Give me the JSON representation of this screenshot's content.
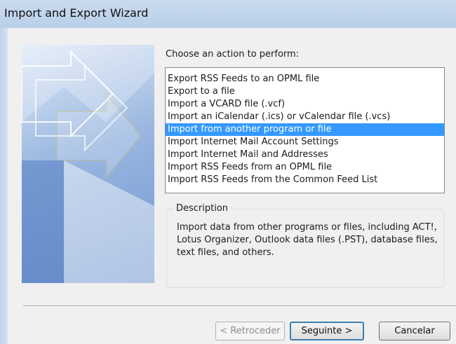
{
  "window": {
    "title": "Import and Export Wizard"
  },
  "main": {
    "prompt": "Choose an action to perform:",
    "actions": [
      {
        "label": "Export RSS Feeds to an OPML file",
        "selected": false
      },
      {
        "label": "Export to a file",
        "selected": false
      },
      {
        "label": "Import a VCARD file (.vcf)",
        "selected": false
      },
      {
        "label": "Import an iCalendar (.ics) or vCalendar file (.vcs)",
        "selected": false
      },
      {
        "label": "Import from another program or file",
        "selected": true
      },
      {
        "label": "Import Internet Mail Account Settings",
        "selected": false
      },
      {
        "label": "Import Internet Mail and Addresses",
        "selected": false
      },
      {
        "label": "Import RSS Feeds from an OPML file",
        "selected": false
      },
      {
        "label": "Import RSS Feeds from the Common Feed List",
        "selected": false
      }
    ],
    "description": {
      "legend": "Description",
      "text": "Import data from other programs or files, including ACT!, Lotus Organizer, Outlook data files (.PST), database files, text files, and others."
    }
  },
  "buttons": {
    "back_label": "< Retroceder",
    "next_label": "Seguinte >",
    "cancel_label": "Cancelar"
  },
  "colors": {
    "selection": "#3399ff",
    "titlebar": "#c9dbef",
    "default_button_border": "#3c7fb1"
  }
}
